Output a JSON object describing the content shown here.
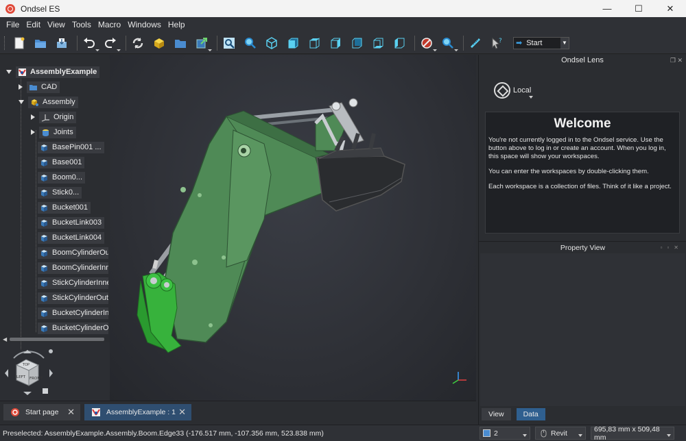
{
  "window": {
    "title": "Ondsel ES",
    "minimize": "—",
    "maximize": "☐",
    "close": "✕"
  },
  "menu": [
    "File",
    "Edit",
    "View",
    "Tools",
    "Macro",
    "Windows",
    "Help"
  ],
  "toolbar": {
    "workbench": "Start"
  },
  "tree": {
    "root": "AssemblyExample",
    "cad": "CAD",
    "assembly": "Assembly",
    "origin": "Origin",
    "joints": "Joints",
    "parts": [
      "BasePin001 ...",
      "Base001",
      "Boom0...",
      "Stick0...",
      "Bucket001",
      "BucketLink003",
      "BucketLink004",
      "BoomCylinderOut",
      "BoomCylinderInne",
      "StickCylinderInner",
      "StickCylinderOute",
      "BucketCylinderInn",
      "BucketCylinderOu"
    ]
  },
  "lens": {
    "title": "Ondsel Lens",
    "login_label": "Local",
    "welcome_title": "Welcome",
    "p1": "You're not currently logged in to the Ondsel service. Use the button above to log in or create an account. When you log in, this space will show your workspaces.",
    "p2": "You can enter the workspaces by double-clicking them.",
    "p3": "Each workspace is a collection of files. Think of it like a project."
  },
  "property": {
    "title": "Property View",
    "tab_view": "View",
    "tab_data": "Data"
  },
  "navcube": {
    "top": "TOP",
    "front": "FRONT",
    "left": "LEFT"
  },
  "doctabs": [
    {
      "label": "Start page",
      "close": "✕"
    },
    {
      "label": "AssemblyExample : 1",
      "close": "✕"
    }
  ],
  "status": {
    "message": "Preselected: AssemblyExample.Assembly.Boom.Edge33 (-176.517 mm, -107.356 mm, 523.838 mm)",
    "draw_style": "2",
    "nav_style": "Revit",
    "dimensions": "695,83 mm x 509,48 mm"
  }
}
